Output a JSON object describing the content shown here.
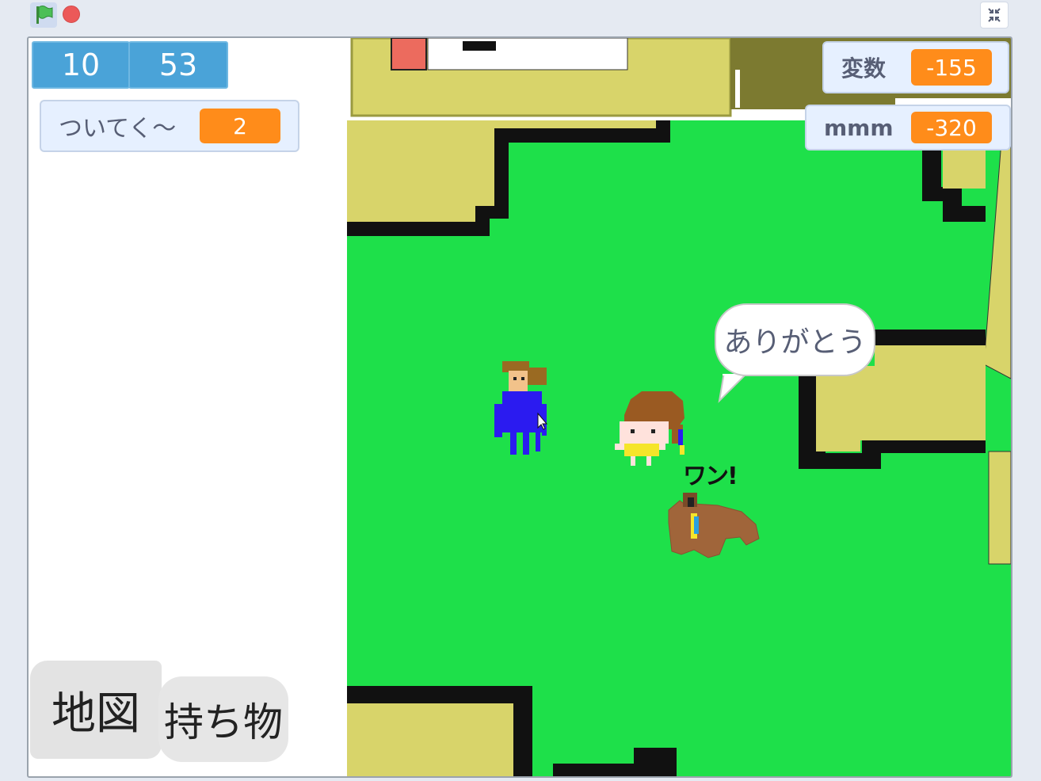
{
  "toolbar": {
    "green_flag": "green-flag-icon",
    "stop": "stop-icon",
    "fullscreen_exit": "shrink-icon"
  },
  "monitors": {
    "num1": "10",
    "num2": "53",
    "follow": {
      "label": "ついてく〜",
      "value": "2"
    },
    "hensu": {
      "label": "変数",
      "value": "-155"
    },
    "mmm": {
      "label": "mmm",
      "value": "-320"
    }
  },
  "speech": {
    "text": "ありがとう"
  },
  "sfx": {
    "text": "ワン!"
  },
  "buttons": {
    "map": "地図",
    "items": "持ち物"
  },
  "colors": {
    "grass": "#1ee04a",
    "building": "#d8d46a",
    "wall": "#111111",
    "monitor_orange": "#ff8c1a",
    "monitor_blue": "#4aa3d8"
  }
}
